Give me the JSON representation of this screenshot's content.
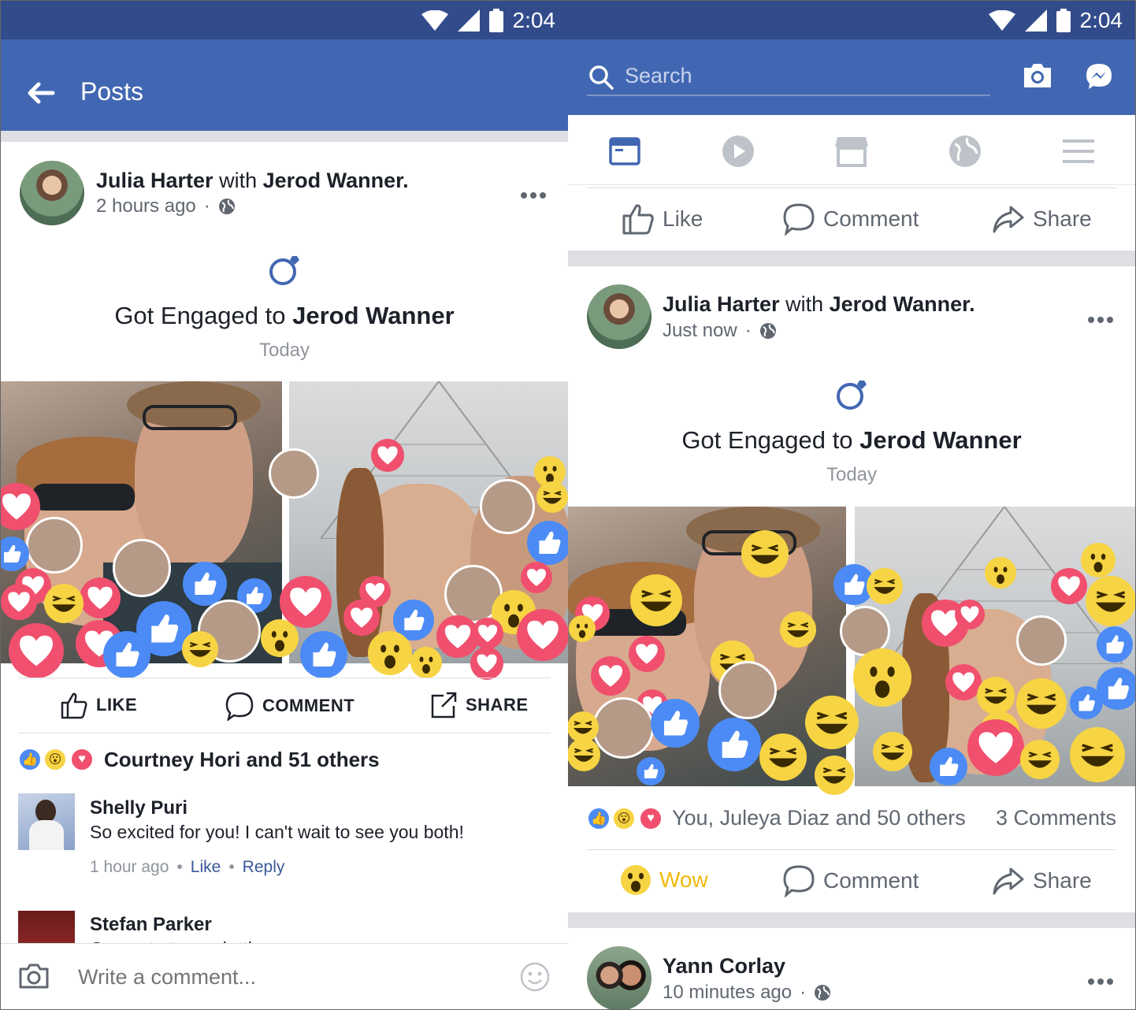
{
  "left": {
    "status": {
      "time": "2:04"
    },
    "header": {
      "title": "Posts"
    },
    "post": {
      "author": "Julia Harter",
      "with_word": "with",
      "tagged": "Jerod Wanner.",
      "time": "2 hours ago",
      "dot": "·",
      "event_prefix": "Got Engaged to",
      "event_name": "Jerod Wanner",
      "event_date": "Today"
    },
    "actions": {
      "like": "LIKE",
      "comment": "COMMENT",
      "share": "SHARE"
    },
    "reactions_summary": "Courtney Hori and 51 others",
    "comments": [
      {
        "name": "Shelly Puri",
        "text": "So excited for you! I can't wait to see you both!",
        "time": "1 hour ago",
        "like": "Like",
        "reply": "Reply",
        "dot": "•"
      },
      {
        "name": "Stefan Parker",
        "text": "Congrats to you both"
      }
    ],
    "composer": {
      "placeholder": "Write a comment..."
    }
  },
  "right": {
    "status": {
      "time": "2:04"
    },
    "search": {
      "placeholder": "Search"
    },
    "prev_actions": {
      "like": "Like",
      "comment": "Comment",
      "share": "Share"
    },
    "post": {
      "author": "Julia Harter",
      "with_word": "with",
      "tagged": "Jerod Wanner.",
      "time": "Just now",
      "dot": "·",
      "event_prefix": "Got Engaged to",
      "event_name": "Jerod Wanner",
      "event_date": "Today"
    },
    "reactions_summary": "You, Juleya Diaz and 50 others",
    "comments_count": "3 Comments",
    "actions": {
      "wow": "Wow",
      "comment": "Comment",
      "share": "Share"
    },
    "next_post": {
      "author": "Yann Corlay",
      "time": "10 minutes ago",
      "dot": "·"
    }
  },
  "colors": {
    "status_bar": "#324b8b",
    "app_bar": "#4267b2",
    "like_blue": "#4c8bf5",
    "love_red": "#f0506e",
    "haha_yellow": "#f7d443",
    "wow_text": "#f0b90b",
    "link": "#385898"
  },
  "icons": [
    "back-arrow-icon",
    "wifi-icon",
    "signal-icon",
    "battery-icon",
    "globe-icon",
    "ring-icon",
    "like-icon",
    "comment-icon",
    "share-icon",
    "camera-icon",
    "smiley-icon",
    "search-icon",
    "messenger-icon",
    "news-feed-icon",
    "video-icon",
    "marketplace-icon",
    "explore-icon",
    "menu-icon"
  ]
}
